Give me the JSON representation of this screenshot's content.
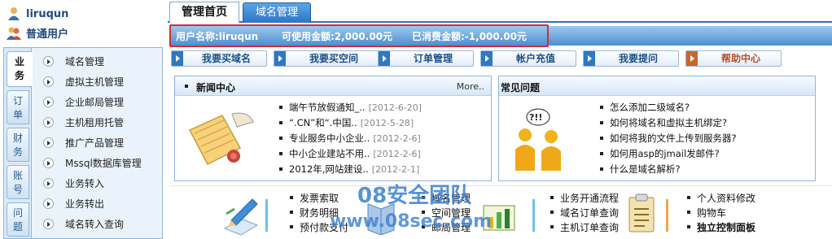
{
  "user": {
    "name": "liruqun",
    "type": "普通用户"
  },
  "leftnav": {
    "tabs": [
      "业务",
      "订单",
      "财务",
      "账号",
      "问题"
    ],
    "items": [
      "域名管理",
      "虚拟主机管理",
      "企业邮局管理",
      "主机租用托管",
      "推广产品管理",
      "Mssql数据库管理",
      "业务转入",
      "业务转出",
      "域名转入查询"
    ]
  },
  "tabs": {
    "home": "管理首页",
    "domain": "域名管理"
  },
  "info": {
    "username": "用户名称:liruqun",
    "available": "可使用金额:2,000.00元",
    "spent": "已消费金额:-1,000.00元"
  },
  "quick_buttons": [
    "我要买域名",
    "我要买空间",
    "订单管理",
    "帐户充值",
    "我要提问",
    "帮助中心"
  ],
  "news": {
    "title": "新闻中心",
    "more": "More..",
    "items": [
      {
        "text": "端午节放假通知_..",
        "date": "[2012-6-20]"
      },
      {
        "text": "“.CN”和“.中国..",
        "date": "[2012-5-28]"
      },
      {
        "text": "专业服务中小企业..",
        "date": "[2012-2-6]"
      },
      {
        "text": "中小企业建站不用..",
        "date": "[2012-2-6]"
      },
      {
        "text": "2012年,网站建设..",
        "date": "[2012-2-1]"
      }
    ]
  },
  "faq": {
    "title": "常见问题",
    "items": [
      "怎么添加二级域名?",
      "如何将域名和虚拟主机绑定?",
      "如何将我的文件上传到服务器?",
      "如何用asp的jmail发邮件?",
      "什么是域名解析?"
    ]
  },
  "bottom": {
    "col1": [
      "发票索取",
      "财务明细",
      "预付款支付"
    ],
    "col2": [
      "域名管理",
      "空间管理",
      "邮局管理"
    ],
    "col3": [
      "业务开通流程",
      "域名订单查询",
      "主机订单查询"
    ],
    "col4": [
      "个人资料修改",
      "购物车",
      "独立控制面板"
    ]
  },
  "watermark": {
    "line1": "08安全团队",
    "line2": "www.08sec.com"
  },
  "colors": {
    "accent": "#2f72b7",
    "highlight_border": "#d42b3a",
    "infobar": "#4d8fd0"
  },
  "icons": [
    "user-icon",
    "users-icon",
    "arrow-icon",
    "scroll-icon",
    "people-question-icon",
    "pencil-icon",
    "book-icon",
    "chart-icon",
    "clipboard-icon"
  ]
}
